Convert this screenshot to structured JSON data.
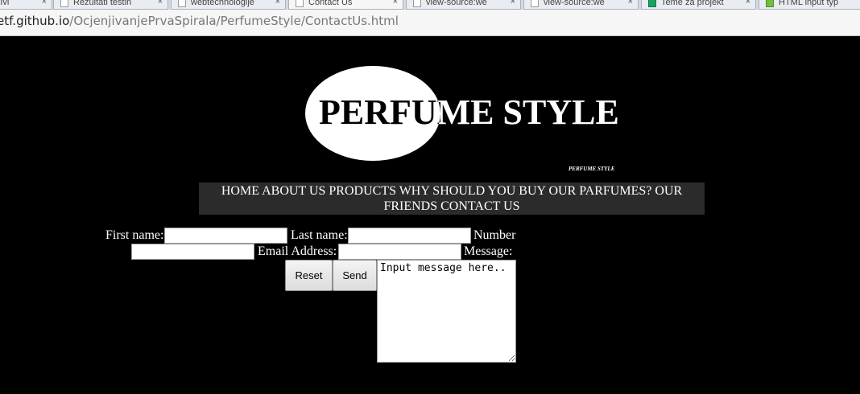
{
  "browser": {
    "tabs": [
      {
        "label": "eri:Ivi",
        "icon": "page-icon"
      },
      {
        "label": "Rezultati testin",
        "icon": "page-icon"
      },
      {
        "label": "webtechnologije",
        "icon": "page-icon"
      },
      {
        "label": "Contact Us",
        "icon": "page-icon",
        "active": true
      },
      {
        "label": "view-source:we",
        "icon": "page-icon"
      },
      {
        "label": "view-source:we",
        "icon": "page-icon"
      },
      {
        "label": "Teme za projekt",
        "icon": "sheet-icon"
      },
      {
        "label": "HTML input typ",
        "icon": "green-icon"
      }
    ],
    "tab_close": "×",
    "url_host": "etf.github.io",
    "url_path": "/OcjenjivanjePrvaSpirala/PerfumeStyle/ContactUs.html"
  },
  "logo": {
    "title": "PERFUME STYLE",
    "small_text": "PERFUME STYLE"
  },
  "nav": {
    "items": [
      "HOME",
      "ABOUT US",
      "PRODUCTS",
      "WHY SHOULD YOU BUY OUR PARFUMES?",
      "OUR FRIENDS",
      "CONTACT US"
    ]
  },
  "form": {
    "first_name_label": "First name:",
    "last_name_label": "Last name:",
    "number_label": "Number",
    "email_label": "Email Address:",
    "message_label": "Message:",
    "first_name_value": "",
    "last_name_value": "",
    "number_value": "",
    "email_value": "",
    "message_placeholder": "Input message here..",
    "reset_label": "Reset",
    "send_label": "Send"
  }
}
